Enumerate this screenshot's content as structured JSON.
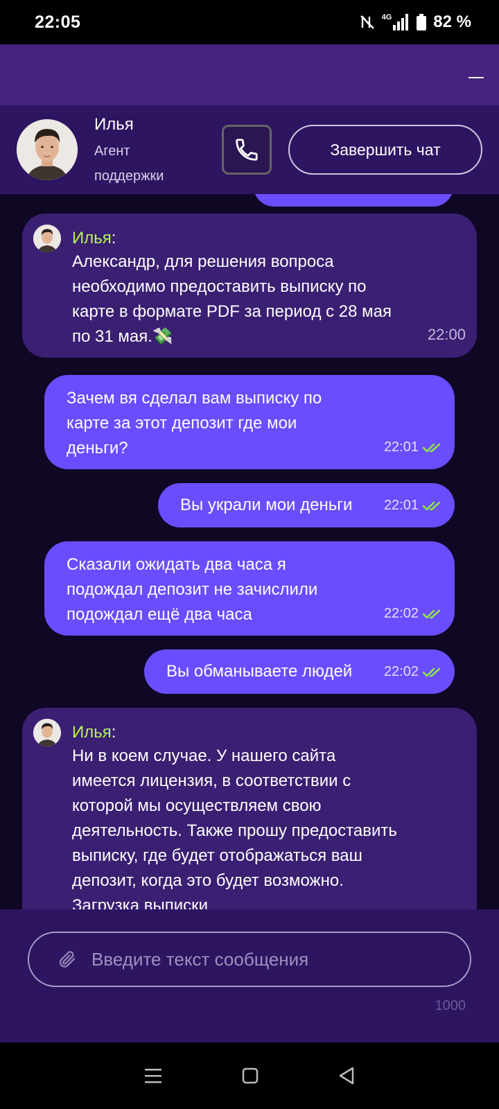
{
  "status_bar": {
    "time": "22:05",
    "network": "4G",
    "battery": "82 %"
  },
  "agent": {
    "name": "Илья",
    "role": "Агент поддержки"
  },
  "header": {
    "end_chat_label": "Завершить чат"
  },
  "messages": [
    {
      "sender": "agent",
      "name": "Илья",
      "text": "Александр, для решения вопроса необходимо предоставить выписку по карте в формате PDF за период с 28 мая по 31 мая.💸",
      "time": "22:00"
    },
    {
      "sender": "user",
      "text": "Зачем вя сделал вам выписку по карте за этот депозит где мои деньги?",
      "time": "22:01"
    },
    {
      "sender": "user",
      "text": "Вы украли мои деньги",
      "time": "22:01"
    },
    {
      "sender": "user",
      "text": "Сказали ожидать два часа я подождал депозит не зачислили подождал ещё два часа",
      "time": "22:02"
    },
    {
      "sender": "user",
      "text": "Вы обманываете людей",
      "time": "22:02"
    },
    {
      "sender": "agent",
      "name": "Илья",
      "text": "Ни в коем случае. У нашего сайта имеется лицензия, в соответствии с которой мы осуществляем свою деятельность. Также прошу предоставить выписку, где будет отображаться ваш депозит, когда это будет возможно. Загрузка выписки"
    }
  ],
  "composer": {
    "placeholder": "Введите текст сообщения",
    "char_limit": "1000"
  },
  "colors": {
    "top_bar": "#45237f",
    "header_bg": "#2d1561",
    "chat_bg": "#0f0724",
    "agent_bubble": "#3a1f72",
    "user_bubble": "#6a4dff",
    "agent_name": "#b6f25a",
    "read_check": "#8ee44c"
  },
  "icons": {
    "call": "phone-icon",
    "attach": "paperclip-icon",
    "read": "double-check-icon",
    "minimize": "minimize-icon"
  }
}
